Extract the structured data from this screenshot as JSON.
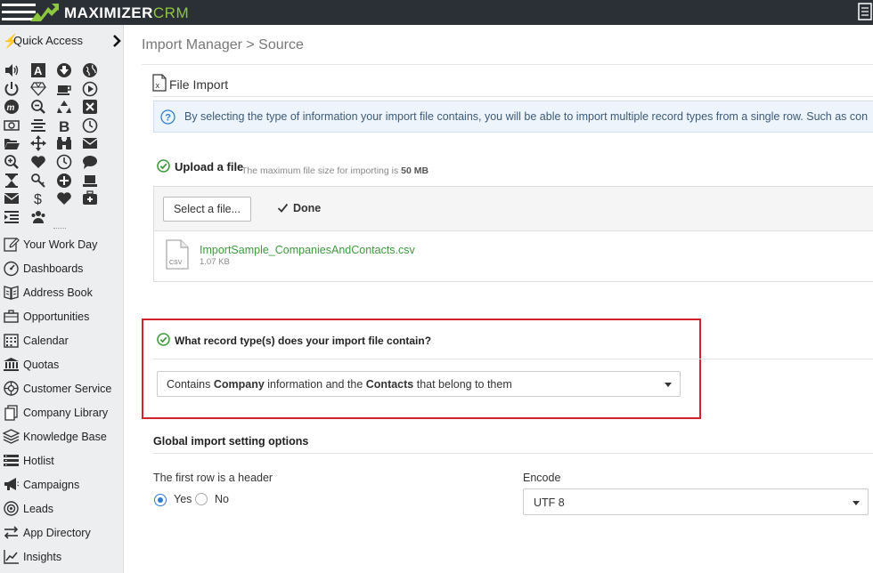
{
  "app": {
    "brand_main": "MAXIMIZER",
    "brand_sub": "CRM"
  },
  "sidebar": {
    "quick_access_label": "Quick Access",
    "quick_icons": [
      "speaker-icon",
      "text-a-icon",
      "arrow-down-circle-icon",
      "globe-icon",
      "power-icon",
      "diamond-icon",
      "coffee-icon",
      "play-circle-icon",
      "maximizer-icon",
      "search-minus-icon",
      "recycle-icon",
      "close-box-icon",
      "money-icon",
      "align-center-icon",
      "bold-icon",
      "clock-icon",
      "folder-open-icon",
      "arrows-move-icon",
      "binoculars-icon",
      "envelope-icon",
      "zoom-in-icon",
      "heart-icon",
      "clock-icon",
      "comment-icon",
      "hourglass-icon",
      "key-icon",
      "plus-circle-icon",
      "laptop-icon",
      "envelope-icon",
      "dollar-icon",
      "heart-icon",
      "medkit-icon",
      "indent-icon",
      "users-icon"
    ],
    "items": [
      {
        "label": "Your Work Day",
        "icon": "edit-icon"
      },
      {
        "label": "Dashboards",
        "icon": "dashboard-icon"
      },
      {
        "label": "Address Book",
        "icon": "address-book-icon"
      },
      {
        "label": "Opportunities",
        "icon": "briefcase-icon"
      },
      {
        "label": "Calendar",
        "icon": "calendar-icon"
      },
      {
        "label": "Quotas",
        "icon": "bank-icon"
      },
      {
        "label": "Customer Service",
        "icon": "lifebuoy-icon"
      },
      {
        "label": "Company Library",
        "icon": "documents-icon"
      },
      {
        "label": "Knowledge Base",
        "icon": "layers-icon"
      },
      {
        "label": "Hotlist",
        "icon": "list-icon"
      },
      {
        "label": "Campaigns",
        "icon": "megaphone-icon"
      },
      {
        "label": "Leads",
        "icon": "target-icon"
      },
      {
        "label": "App Directory",
        "icon": "exchange-icon"
      },
      {
        "label": "Insights",
        "icon": "line-chart-icon"
      }
    ]
  },
  "main": {
    "breadcrumb_root": "Import Manager",
    "breadcrumb_current": "> Source",
    "file_import_title": "File Import",
    "info_text": "By selecting the type of information your import file contains, you will be able to import multiple record types from a single row. Such as con",
    "upload": {
      "title": "Upload a file",
      "note_prefix": "The maximum file size for importing is",
      "note_value": "50 MB",
      "select_button": "Select a file...",
      "done_label": "Done",
      "file_icon_text": "CSV",
      "file_name": "ImportSample_CompaniesAndContacts.csv",
      "file_size": "1.07 KB"
    },
    "record_type": {
      "title": "What record type(s) does your import file contain?",
      "select_p1": "Contains",
      "select_b1": "Company",
      "select_p2": "information and the",
      "select_b2": "Contacts",
      "select_p3": "that belong to them"
    },
    "global": {
      "title": "Global import setting options",
      "header_question": "The first row is a header",
      "yes_label": "Yes",
      "no_label": "No",
      "header_selected": "Yes",
      "encode_label": "Encode",
      "encode_value": "UTF 8"
    }
  },
  "colors": {
    "topbar": "#2b3036",
    "brand_green": "#8dc63f",
    "check_green": "#3c9b3c",
    "highlight_red": "#d3222a",
    "radio_blue": "#2e7bcf"
  }
}
